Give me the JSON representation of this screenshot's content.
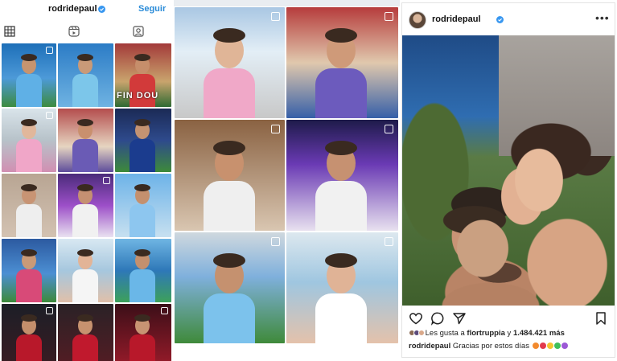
{
  "profile": {
    "username": "rodridepaul",
    "follow_label": "Seguir",
    "tabs": [
      {
        "name": "grid-icon"
      },
      {
        "name": "reels-icon"
      },
      {
        "name": "tagged-icon"
      }
    ]
  },
  "grid1": [
    {
      "bg": "linear-gradient(180deg,#1d6fb8,#4d9ad8 55%,#3c8b3f)",
      "skin": "#c7946f",
      "shirt": "#5fb0e6",
      "multi": true
    },
    {
      "bg": "linear-gradient(180deg,#2c7cc6,#6fb3e2)",
      "skin": "#c99a78",
      "shirt": "#7cc6ea",
      "multi": false
    },
    {
      "bg": "linear-gradient(180deg,#a33a3a,#c9a46d 60%,#2f6a33)",
      "skin": "#c68e6b",
      "shirt": "#d23a3a",
      "multi": false
    },
    {
      "bg": "linear-gradient(180deg,#d9e4ea,#b7c2c9 50%,#d18fb2)",
      "skin": "#e1b79b",
      "shirt": "#f0a6c8",
      "multi": true
    },
    {
      "bg": "linear-gradient(180deg,#b44d4d,#e6d5c1 60%,#5d4c9b)",
      "skin": "#c9906e",
      "shirt": "#6a5bb5",
      "multi": false
    },
    {
      "bg": "linear-gradient(180deg,#1b2a55,#2e4a8c 50%,#3d8a3a)",
      "skin": "#c49372",
      "shirt": "#1b3c8e",
      "multi": false
    },
    {
      "bg": "linear-gradient(180deg,#b8a593,#d3c2b2)",
      "skin": "#c89474",
      "shirt": "#eee",
      "multi": false
    },
    {
      "bg": "linear-gradient(180deg,#4a2b7a,#9c4fc8 50%,#e9e1f0)",
      "skin": "#c59072",
      "shirt": "#f1f1f1",
      "multi": true
    },
    {
      "bg": "linear-gradient(180deg,#6db3e8,#c7e0f0)",
      "skin": "#c4906e",
      "shirt": "#8dc6ef",
      "multi": false
    },
    {
      "bg": "linear-gradient(180deg,#2c5aa0,#4c8fd3 55%,#3d8a3a)",
      "skin": "#c99a78",
      "shirt": "#d84a78",
      "multi": false
    },
    {
      "bg": "linear-gradient(180deg,#d8e8f2,#a6c7de 50%,#e0c0aa)",
      "skin": "#e2b497",
      "shirt": "#f5f5f5",
      "multi": false
    },
    {
      "bg": "linear-gradient(180deg,#6fb5e3,#2e78b8 50%,#3da05a)",
      "skin": "#c4906e",
      "shirt": "#6ab7e8",
      "multi": false
    },
    {
      "bg": "linear-gradient(180deg,#1c1f27,#3a1b22)",
      "skin": "#c48e6c",
      "shirt": "#b8182a",
      "multi": true
    },
    {
      "bg": "linear-gradient(180deg,#2a2226,#551c24)",
      "skin": "#c7926f",
      "shirt": "#c0192d",
      "multi": false
    },
    {
      "bg": "linear-gradient(180deg,#3b0f18,#9a1b2a)",
      "skin": "#c89473",
      "shirt": "#b8182a",
      "multi": true
    }
  ],
  "tile_text": "FIN DOU",
  "grid2": [
    {
      "bg": "linear-gradient(180deg,#a9c7e3,#e3eef6 40%,#c8c8c8)",
      "skin": "#e0b597",
      "shirt": "#f0a8c8",
      "multi": true
    },
    {
      "bg": "linear-gradient(180deg,#b63c3c,#e0c8ad 50%,#355fa8)",
      "skin": "#cf9a79",
      "shirt": "#6c5bbd",
      "multi": true
    },
    {
      "bg": "linear-gradient(180deg,#8a6242,#d9c6b1)",
      "skin": "#c8916e",
      "shirt": "#efefef",
      "multi": true
    },
    {
      "bg": "linear-gradient(180deg,#1e1b4a,#6a3ab4 40%,#e8e1ef)",
      "skin": "#c69171",
      "shirt": "#f1f1f1",
      "multi": true
    },
    {
      "bg": "linear-gradient(180deg,#cfd8de,#7fb0dc 40%,#3f8a3a)",
      "skin": "#c5916f",
      "shirt": "#7cc2ec",
      "multi": true
    },
    {
      "bg": "linear-gradient(180deg,#dde8ef,#9fc6e0 45%,#e4c2ab)",
      "skin": "#e0b396",
      "shirt": "#ffffff",
      "multi": true
    }
  ],
  "post": {
    "username": "rodridepaul",
    "likes_prefix": "Les gusta a ",
    "likes_user": "flortruppia",
    "likes_mid": " y ",
    "likes_count": "1.484.421",
    "likes_suffix": " más",
    "caption_user": "rodridepaul",
    "caption_text": " Gracias por estos días",
    "caption_hearts": [
      "#f28a2e",
      "#e23a4d",
      "#f4c430",
      "#3fbf5a",
      "#9b59d6"
    ],
    "like_faces": [
      "#8b6a55",
      "#5a4a7a",
      "#d9a88a"
    ]
  },
  "colors": {
    "accent": "#2a8bd8",
    "verified": "#3897f0"
  }
}
